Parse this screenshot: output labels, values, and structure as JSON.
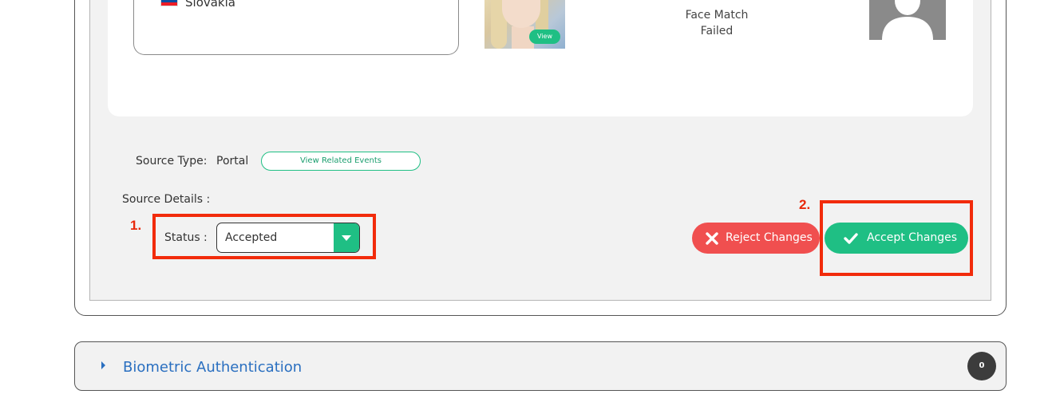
{
  "identity_card": {
    "country": "Slovakia",
    "photo_view_label": "View",
    "face_match_line1": "Face Match",
    "face_match_line2": "Failed"
  },
  "source": {
    "type_label": "Source Type:",
    "type_value": "Portal",
    "related_events_label": "View Related Events",
    "details_label": "Source Details :"
  },
  "status": {
    "label": "Status :",
    "selected": "Accepted"
  },
  "actions": {
    "reject_label": "Reject Changes",
    "accept_label": "Accept Changes"
  },
  "annotations": {
    "step1": "1.",
    "step2": "2."
  },
  "biometric_section": {
    "title": "Biometric Authentication",
    "count": "0"
  },
  "colors": {
    "accent_green": "#1fbf84",
    "reject_red": "#f04f4f",
    "annotation_red": "#f22b0b",
    "link_blue": "#2a6fc0"
  }
}
